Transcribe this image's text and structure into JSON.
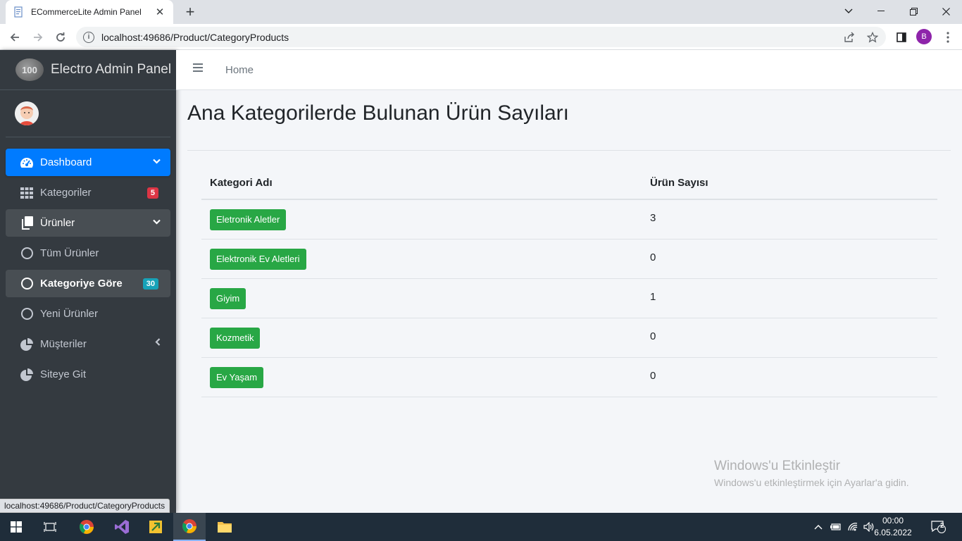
{
  "browser": {
    "tab_title": "ECommerceLite Admin Panel",
    "url": "localhost:49686/Product/CategoryProducts",
    "profile_initial": "B",
    "status_url": "localhost:49686/Product/CategoryProducts"
  },
  "sidebar": {
    "brand": "Electro Admin Panel",
    "brand_logo_text": "100",
    "items": [
      {
        "label": "Dashboard",
        "icon": "tachometer-icon",
        "state": "active",
        "chevron": "down"
      },
      {
        "label": "Kategoriler",
        "icon": "grid-icon",
        "badge": "5",
        "badge_color": "#dc3545"
      },
      {
        "label": "Ürünler",
        "icon": "copy-icon",
        "state": "open",
        "chevron": "down"
      },
      {
        "label": "Tüm Ürünler",
        "icon": "circle-icon"
      },
      {
        "label": "Kategoriye Göre",
        "icon": "circle-icon",
        "state": "open",
        "badge": "30",
        "badge_color": "#17a2b8"
      },
      {
        "label": "Yeni Ürünler",
        "icon": "circle-icon"
      },
      {
        "label": "Müşteriler",
        "icon": "pie-chart-icon",
        "chevron": "left"
      },
      {
        "label": "Siteye Git",
        "icon": "pie-chart-icon"
      }
    ]
  },
  "topnav": {
    "home_label": "Home"
  },
  "main": {
    "title": "Ana Kategorilerde Bulunan Ürün Sayıları",
    "table": {
      "headers": [
        "Kategori Adı",
        "Ürün Sayısı"
      ],
      "rows": [
        {
          "category": "Eletronik Aletler",
          "count": "3"
        },
        {
          "category": "Elektronik Ev Aletleri",
          "count": "0"
        },
        {
          "category": "Giyim",
          "count": "1"
        },
        {
          "category": "Kozmetik",
          "count": "0"
        },
        {
          "category": "Ev Yaşam",
          "count": "0"
        }
      ]
    }
  },
  "watermark": {
    "line1": "Windows'u Etkinleştir",
    "line2": "Windows'u etkinleştirmek için Ayarlar'a gidin."
  },
  "taskbar": {
    "time": "00:00",
    "date": "6.05.2022",
    "notifications": "2"
  },
  "colors": {
    "primary": "#007bff",
    "success": "#28a745",
    "sidebar_bg": "#343a40"
  }
}
